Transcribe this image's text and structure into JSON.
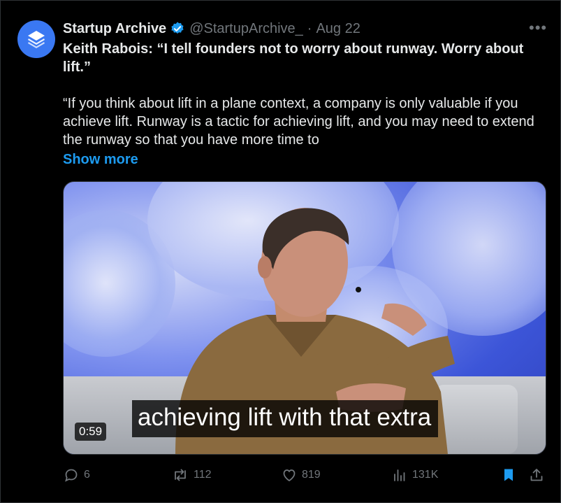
{
  "tweet": {
    "author_name": "Startup Archive",
    "handle": "@StartupArchive_",
    "separator": "·",
    "date": "Aug 22",
    "more_icon": "more-icon",
    "headline": "Keith Rabois: “I tell founders not to worry about runway. Worry about lift.”",
    "quote": "“If you think about lift in a plane context, a company is only valuable if you achieve lift. Runway is a tactic for achieving lift, and you may need to extend the runway so that you have more time to",
    "show_more": "Show more"
  },
  "media": {
    "caption": "achieving lift with that extra",
    "duration": "0:59"
  },
  "actions": {
    "replies": "6",
    "reposts": "112",
    "likes": "819",
    "views": "131K"
  },
  "colors": {
    "accent": "#1d9bf0",
    "avatar": "#3a78f2",
    "muted": "#71767b"
  }
}
